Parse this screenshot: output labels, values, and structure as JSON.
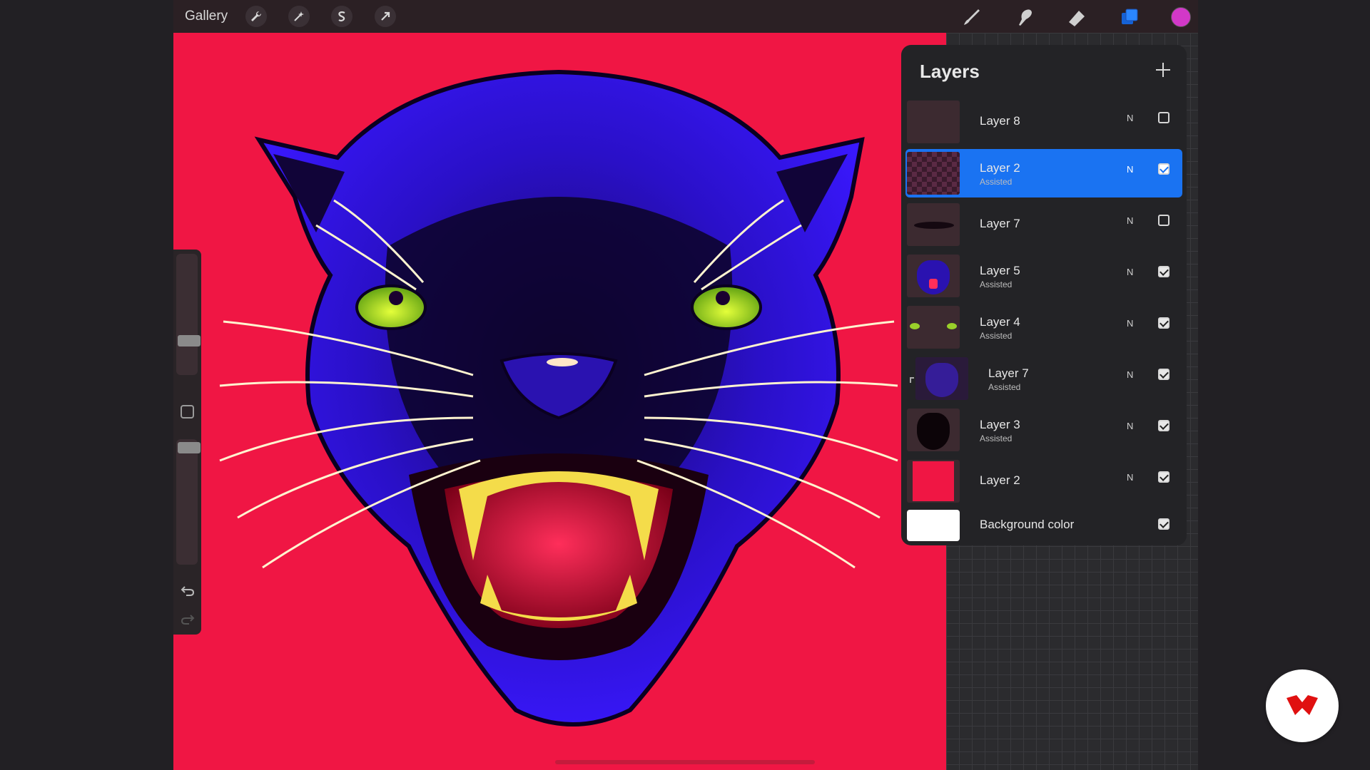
{
  "toolbar": {
    "gallery_label": "Gallery",
    "color_swatch": "#d238c8",
    "active_tool_color": "#1a73f2"
  },
  "canvas": {
    "background_color": "#f01644",
    "subject": "panther-illustration"
  },
  "layers_panel": {
    "title": "Layers",
    "add_icon": "plus-icon",
    "rows": [
      {
        "name": "Layer 8",
        "subtitle": "",
        "blend": "N",
        "visible": false,
        "active": false
      },
      {
        "name": "Layer 2",
        "subtitle": "Assisted",
        "blend": "N",
        "visible": true,
        "active": true
      },
      {
        "name": "Layer 7",
        "subtitle": "",
        "blend": "N",
        "visible": false,
        "active": false
      },
      {
        "name": "Layer 5",
        "subtitle": "Assisted",
        "blend": "N",
        "visible": true,
        "active": false
      },
      {
        "name": "Layer 4",
        "subtitle": "Assisted",
        "blend": "N",
        "visible": true,
        "active": false
      },
      {
        "name": "Layer 7",
        "subtitle": "Assisted",
        "blend": "N",
        "visible": true,
        "active": false,
        "clipped": true
      },
      {
        "name": "Layer 3",
        "subtitle": "Assisted",
        "blend": "N",
        "visible": true,
        "active": false
      },
      {
        "name": "Layer 2",
        "subtitle": "",
        "blend": "N",
        "visible": true,
        "active": false
      }
    ],
    "background": {
      "name": "Background color",
      "visible": true,
      "color": "#ffffff"
    }
  },
  "sidebar": {
    "brush_size": 0.3,
    "opacity": 0.06
  }
}
